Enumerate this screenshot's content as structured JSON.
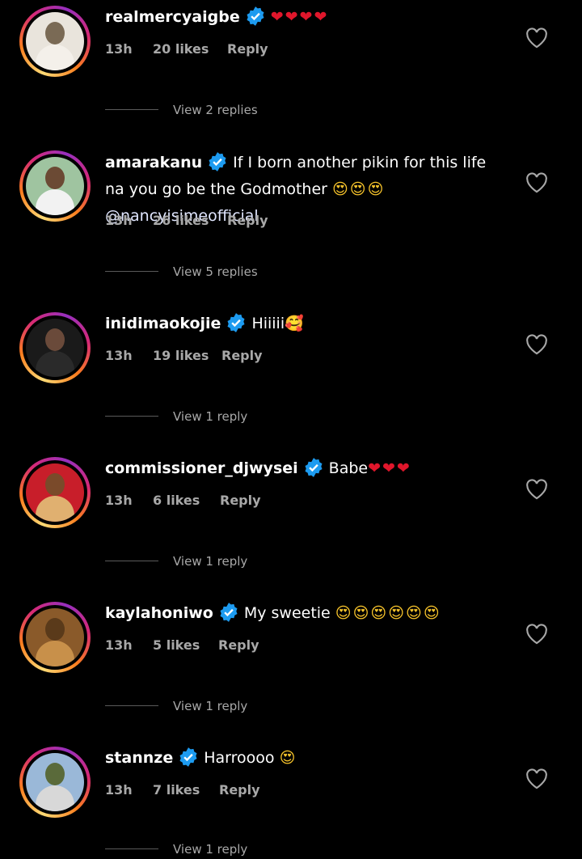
{
  "comments": [
    {
      "username": "realmercyaigbe",
      "text": "",
      "emojis": "❤❤❤❤",
      "emoji_kind": "heart",
      "time": "13h",
      "likes": "20 likes",
      "reply": "Reply",
      "view_replies": "View 2 replies",
      "avatar_colors": [
        "#e9e4dc",
        "#f4f0ea",
        "#7a6a55"
      ]
    },
    {
      "username": "amarakanu",
      "text": "If I born another pikin for this life na you go be the Godmother",
      "emojis": "😍😍😍",
      "emoji_kind": "face",
      "mention": "@nancyisimeofficial",
      "time": "13h",
      "likes": "26 likes",
      "reply": "Reply",
      "view_replies": "View 5 replies",
      "avatar_colors": [
        "#9fc4a0",
        "#f2f2f2",
        "#6b4a34"
      ]
    },
    {
      "username": "inidimaokojie",
      "text": "Hiiiii",
      "emojis": "🥰",
      "emoji_kind": "face",
      "time": "13h",
      "likes": "19 likes",
      "reply": "Reply",
      "view_replies": "View 1 reply",
      "avatar_colors": [
        "#1a1a1a",
        "#2a2a2a",
        "#6a4a3a"
      ]
    },
    {
      "username": "commissioner_djwysei",
      "text": "Babe",
      "emojis": "❤❤❤",
      "emoji_kind": "heart",
      "time": "13h",
      "likes": "6 likes",
      "reply": "Reply",
      "view_replies": "View 1 reply",
      "avatar_colors": [
        "#c81e2a",
        "#e0b070",
        "#7a4a2a"
      ]
    },
    {
      "username": "kaylahoniwo",
      "text": "My sweetie",
      "emojis": "😍😍😍😍😍😍",
      "emoji_kind": "face",
      "time": "13h",
      "likes": "5 likes",
      "reply": "Reply",
      "view_replies": "View 1 reply",
      "avatar_colors": [
        "#8a5a2a",
        "#c8904a",
        "#5a3a1a"
      ]
    },
    {
      "username": "stannze",
      "text": "Harroooo",
      "emojis": "😍",
      "emoji_kind": "face",
      "time": "13h",
      "likes": "7 likes",
      "reply": "Reply",
      "view_replies": "View 1 reply",
      "avatar_colors": [
        "#9ab8d8",
        "#d8d8d8",
        "#5a6a3a"
      ]
    }
  ],
  "icons": {
    "verified": "verified-badge-icon",
    "like": "heart-outline-icon"
  },
  "colors": {
    "background": "#000000",
    "verified": "#1d9bf0",
    "meta": "#a8a8a8"
  }
}
